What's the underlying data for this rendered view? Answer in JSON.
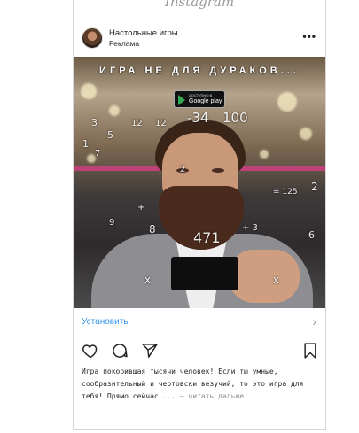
{
  "app": {
    "logo_text": "Instagram"
  },
  "post": {
    "account_name": "Настольные игры",
    "account_subtitle": "Реклама",
    "more_glyph": "•••",
    "avatar_icon": "avatar-photo"
  },
  "media": {
    "headline": "ИГРА НЕ ДЛЯ ДУРАКОВ...",
    "store_badge": {
      "top_text": "ДОСТУПНО В",
      "main_text": "Google play"
    },
    "math_overlays": [
      "-34",
      "100",
      "3",
      "5",
      "12",
      "12",
      "1",
      "7",
      "= 125",
      "2",
      "+",
      "x",
      "x",
      "471",
      "8",
      "9",
      "+ 3",
      "6",
      "2"
    ]
  },
  "cta": {
    "label": "Установить",
    "chevron": "›"
  },
  "actions": {
    "icons": [
      "heart-icon",
      "comment-icon",
      "share-icon",
      "bookmark-icon"
    ]
  },
  "caption": {
    "text": "Игра покорившая тысячи человек! Если ты умные, сообразительный и чертовски везучий, то это игра для тебя! Прямо сейчас ...",
    "more_label": "— читать дальше"
  }
}
